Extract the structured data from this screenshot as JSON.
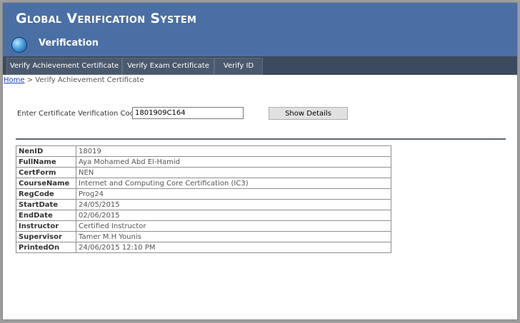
{
  "header": {
    "site_title": "Global Verification System",
    "section_title": "Verification",
    "icon": "globe-icon"
  },
  "nav": {
    "tabs": [
      {
        "label": "Verify Achievement Certificate"
      },
      {
        "label": "Verify Exam Certificate"
      },
      {
        "label": "Verify ID"
      }
    ]
  },
  "breadcrumb": {
    "home": "Home",
    "separator": ">",
    "current": "Verify Achievement Certificate"
  },
  "form": {
    "code_label": "Enter Certificate Verification Code",
    "code_value": "1801909C164",
    "button_label": "Show Details"
  },
  "details": {
    "rows": [
      {
        "key": "NenID",
        "value": "18019"
      },
      {
        "key": "FullName",
        "value": "Aya Mohamed Abd El-Hamid"
      },
      {
        "key": "CertForm",
        "value": "NEN"
      },
      {
        "key": "CourseName",
        "value": "Internet and Computing Core Certification (IC3)"
      },
      {
        "key": "RegCode",
        "value": "Prog24"
      },
      {
        "key": "StartDate",
        "value": "24/05/2015"
      },
      {
        "key": "EndDate",
        "value": "02/06/2015"
      },
      {
        "key": "Instructor",
        "value": "Certified Instructor"
      },
      {
        "key": "Supervisor",
        "value": "Tamer M.H Younis"
      },
      {
        "key": "PrintedOn",
        "value": "24/06/2015 12:10 PM"
      }
    ]
  },
  "colors": {
    "header_bg": "#4a6fa5",
    "nav_bg": "#3c4a5e",
    "link": "#1a3fcf"
  }
}
